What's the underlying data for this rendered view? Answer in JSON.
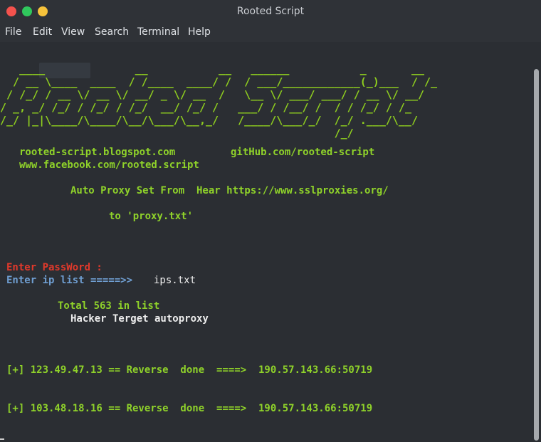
{
  "window": {
    "title": "Rooted Script"
  },
  "menu": [
    "File",
    "Edit",
    "View",
    "Search",
    "Terminal",
    "Help"
  ],
  "banner": {
    "art": "   ____              __           __   ______           _       __\n  / __ \\____  ____  / /____  ____/ /  / ___/____________(_)___  / /_\n / /_/ / __ \\/ __ \\/ __/ _ \\/ __  /   \\__ \\/ ___/ ___/ / __ \\/ __/\n/ _, _/ /_/ / /_/ / /_/  __/ /_/ /   ___/ / /__/ /  / / /_/ / /_\n/_/ |_|\\____/\\____/\\__/\\___/\\__,_/   /____/\\___/_/  /_/ .___/\\__/\n                                                    /_/",
    "blog": "rooted-script.blogspot.com",
    "github": "gitHub.com/rooted-script",
    "facebook": "www.facebook.com/rooted.script",
    "proxy_line": "Auto Proxy Set From  Hear https://www.sslproxies.org/",
    "proxy_file_line": "to 'proxy.txt'"
  },
  "prompts": {
    "password": "Enter PassWord :",
    "ip_list": "Enter ip list =====>>",
    "ip_list_value": "ips.txt"
  },
  "status": {
    "total": "Total 563 in list",
    "mode": "Hacker Terget autoproxy"
  },
  "results": [
    "[+] 123.49.47.13 == Reverse  done  ====>  190.57.143.66:50719",
    "[+] 103.48.18.16 == Reverse  done  ====>  190.57.143.66:50719"
  ]
}
